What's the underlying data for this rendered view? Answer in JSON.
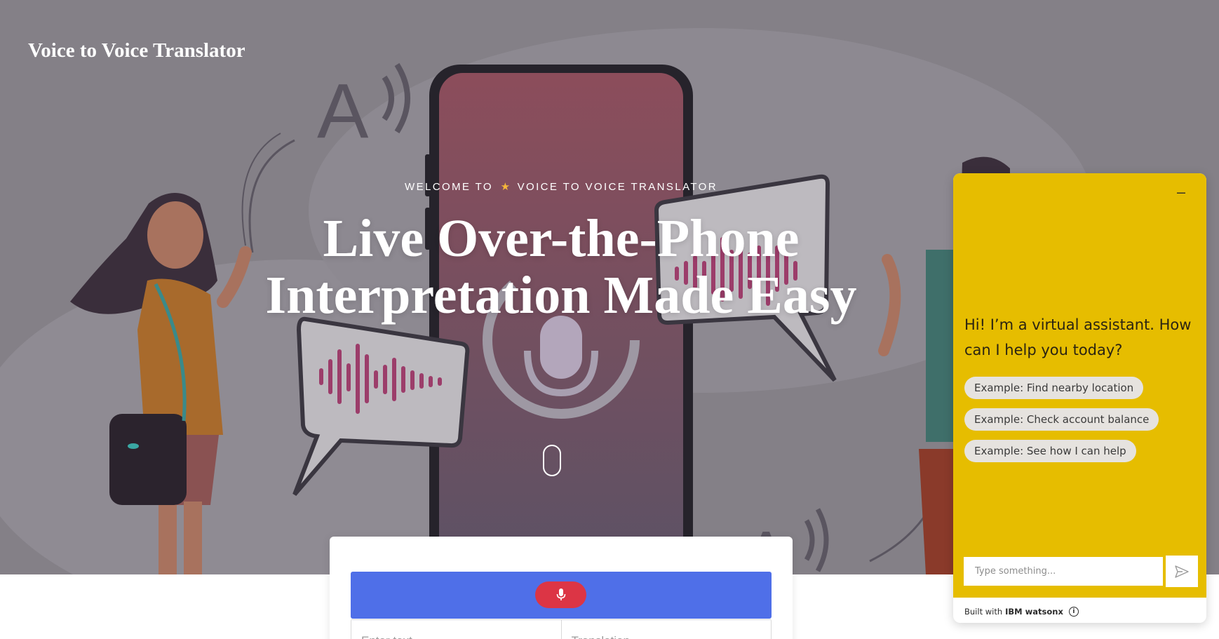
{
  "site": {
    "title": "Voice to Voice Translator"
  },
  "hero": {
    "welcome_prefix": "WELCOME TO",
    "welcome_star": "★",
    "welcome_suffix": "VOICE TO VOICE TRANSLATOR",
    "headline_line1": "Live Over-the-Phone",
    "headline_line2": "Interpretation Made Easy",
    "illustration_letter": "A"
  },
  "translator": {
    "mic_icon": "microphone-icon",
    "input_placeholder": "Enter text",
    "output_placeholder": "Translation"
  },
  "chat": {
    "minimize_icon": "minus-icon",
    "greeting": "Hi! I’m a virtual assistant. How can I help you today?",
    "suggestions": [
      "Example: Find nearby location",
      "Example: Check account balance",
      "Example: See how I can help"
    ],
    "input_placeholder": "Type something...",
    "send_icon": "send-icon",
    "footer_prefix": "Built with",
    "footer_brand": "IBM watsonx",
    "info_icon_glyph": "i"
  },
  "colors": {
    "hero_overlay": "#848087",
    "record_bar": "#4f6fe8",
    "mic_button": "#dc3545",
    "chat_accent": "#e6bd00",
    "chip": "#e6e3df"
  }
}
